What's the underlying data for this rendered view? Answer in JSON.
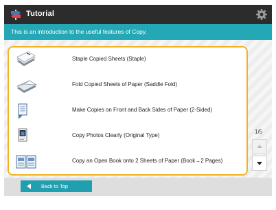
{
  "header": {
    "title": "Tutorial",
    "title_icon": "tutorial-signpost-icon",
    "settings_icon": "gear-icon"
  },
  "info": {
    "text": "This is an introduction to the useful features of Copy."
  },
  "features": [
    {
      "label": "Staple Copied Sheets (Staple)",
      "icon": "staple-icon"
    },
    {
      "label": "Fold Copied Sheets of Paper (Saddle Fold)",
      "icon": "saddle-fold-icon"
    },
    {
      "label": "Make Copies on Front and Back Sides of Paper (2-Sided)",
      "icon": "two-sided-icon"
    },
    {
      "label": "Copy Photos Clearly (Original Type)",
      "icon": "original-type-icon"
    },
    {
      "label": "Copy an Open Book onto 2 Sheets of Paper (Book→2 Pages)",
      "icon": "book-two-pages-icon"
    }
  ],
  "pagination": {
    "current": 1,
    "total": 5,
    "label": "1/5"
  },
  "footer": {
    "back_label": "Back to Top"
  },
  "colors": {
    "title_bar": "#2c2c2c",
    "info_bar": "#25a8b6",
    "selection_border": "#f3b21f",
    "back_button": "#1f9fb0"
  }
}
